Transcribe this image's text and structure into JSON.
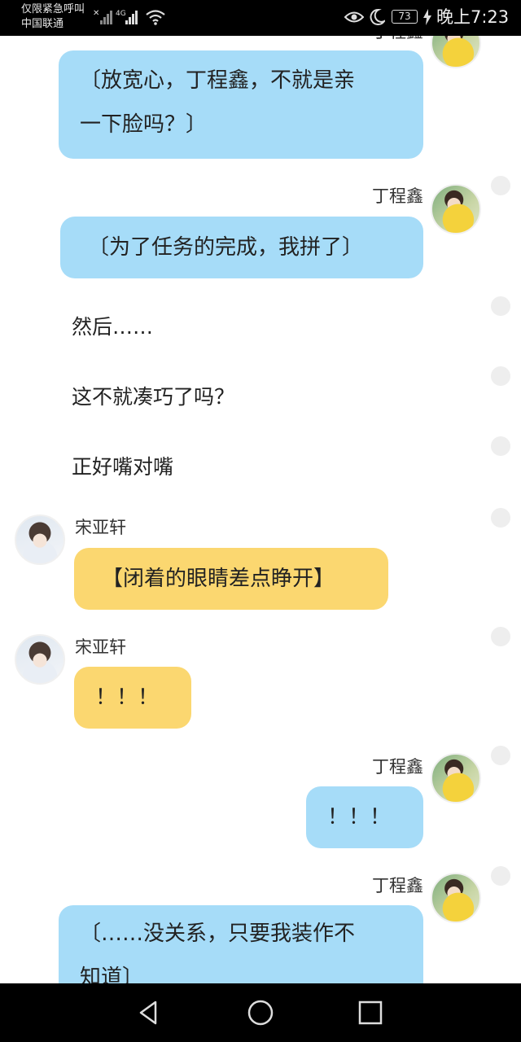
{
  "status_bar": {
    "carrier_line1": "仅限紧急呼叫",
    "carrier_line2": "中国联通",
    "network_type": "4G",
    "battery": "73",
    "time": "晚上7:23",
    "icons": [
      "signal-x-icon",
      "signal-4g-icon",
      "wifi-icon",
      "eye-icon",
      "moon-icon",
      "battery-icon",
      "charging-icon"
    ]
  },
  "chat": {
    "messages": [
      {
        "type": "bubble",
        "speaker": "丁程鑫",
        "side": "right",
        "color": "blue",
        "text_line1": "〔放宽心，丁程鑫，不就是亲",
        "text_line2": "一下脸吗？〕"
      },
      {
        "type": "bubble",
        "speaker": "丁程鑫",
        "side": "right",
        "color": "blue",
        "text": "〔为了任务的完成，我拼了〕"
      },
      {
        "type": "narration",
        "text": "然后……"
      },
      {
        "type": "narration",
        "text": "这不就凑巧了吗？"
      },
      {
        "type": "narration",
        "text": "正好嘴对嘴"
      },
      {
        "type": "bubble",
        "speaker": "宋亚轩",
        "side": "left",
        "color": "yellow",
        "text": "【闭着的眼睛差点睁开】"
      },
      {
        "type": "bubble",
        "speaker": "宋亚轩",
        "side": "left",
        "color": "yellow",
        "text": "！！！"
      },
      {
        "type": "bubble",
        "speaker": "丁程鑫",
        "side": "right",
        "color": "blue",
        "text": "！！！"
      },
      {
        "type": "bubble",
        "speaker": "丁程鑫",
        "side": "right",
        "color": "blue",
        "text_line1": "〔……没关系，只要我装作不",
        "text_line2": "知道〕"
      }
    ]
  },
  "colors": {
    "blue_bubble": "#a6dcf8",
    "yellow_bubble": "#fbd770",
    "status_bg": "#000000"
  },
  "nav_bar": {
    "buttons": [
      "back-icon",
      "home-icon",
      "recents-icon"
    ]
  }
}
